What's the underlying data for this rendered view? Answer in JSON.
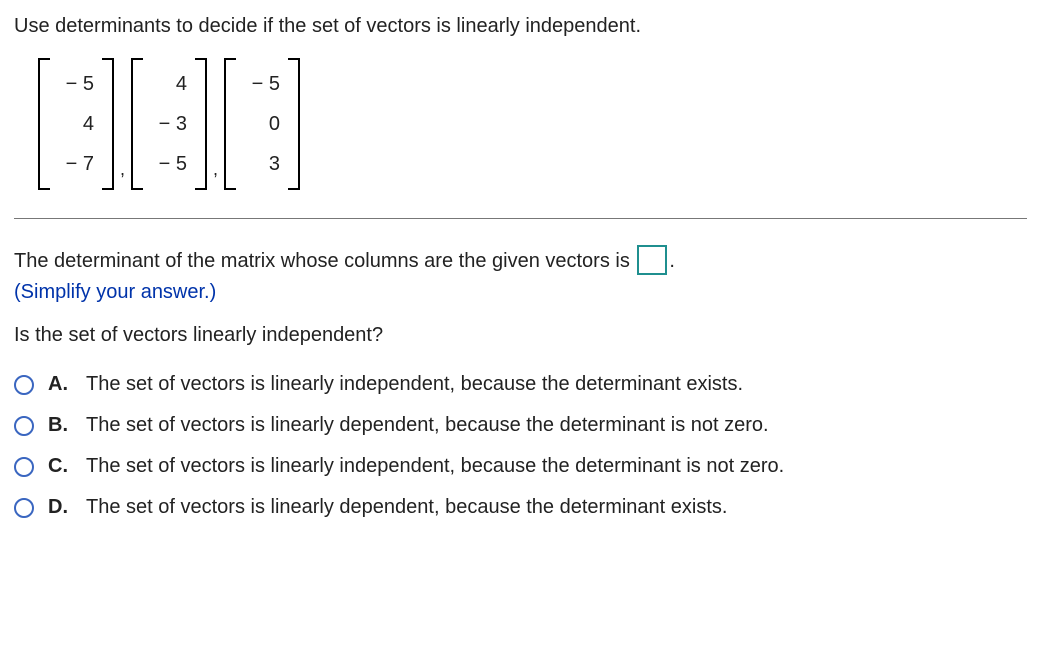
{
  "question": "Use determinants to decide if the set of vectors is linearly independent.",
  "vectors": [
    [
      "− 5",
      "4",
      "− 7"
    ],
    [
      "4",
      "− 3",
      "− 5"
    ],
    [
      "− 5",
      "0",
      "3"
    ]
  ],
  "answer_prompt_before": "The determinant of the matrix whose columns are the given vectors is ",
  "answer_prompt_after": ".",
  "hint": "(Simplify your answer.)",
  "sub_question": "Is the set of vectors linearly independent?",
  "options": [
    {
      "label": "A.",
      "text": "The set of vectors is linearly independent, because the determinant exists."
    },
    {
      "label": "B.",
      "text": "The set of vectors is linearly dependent, because the determinant is not zero."
    },
    {
      "label": "C.",
      "text": "The set of vectors is linearly independent, because the determinant is not zero."
    },
    {
      "label": "D.",
      "text": "The set of vectors is linearly dependent, because the determinant exists."
    }
  ]
}
